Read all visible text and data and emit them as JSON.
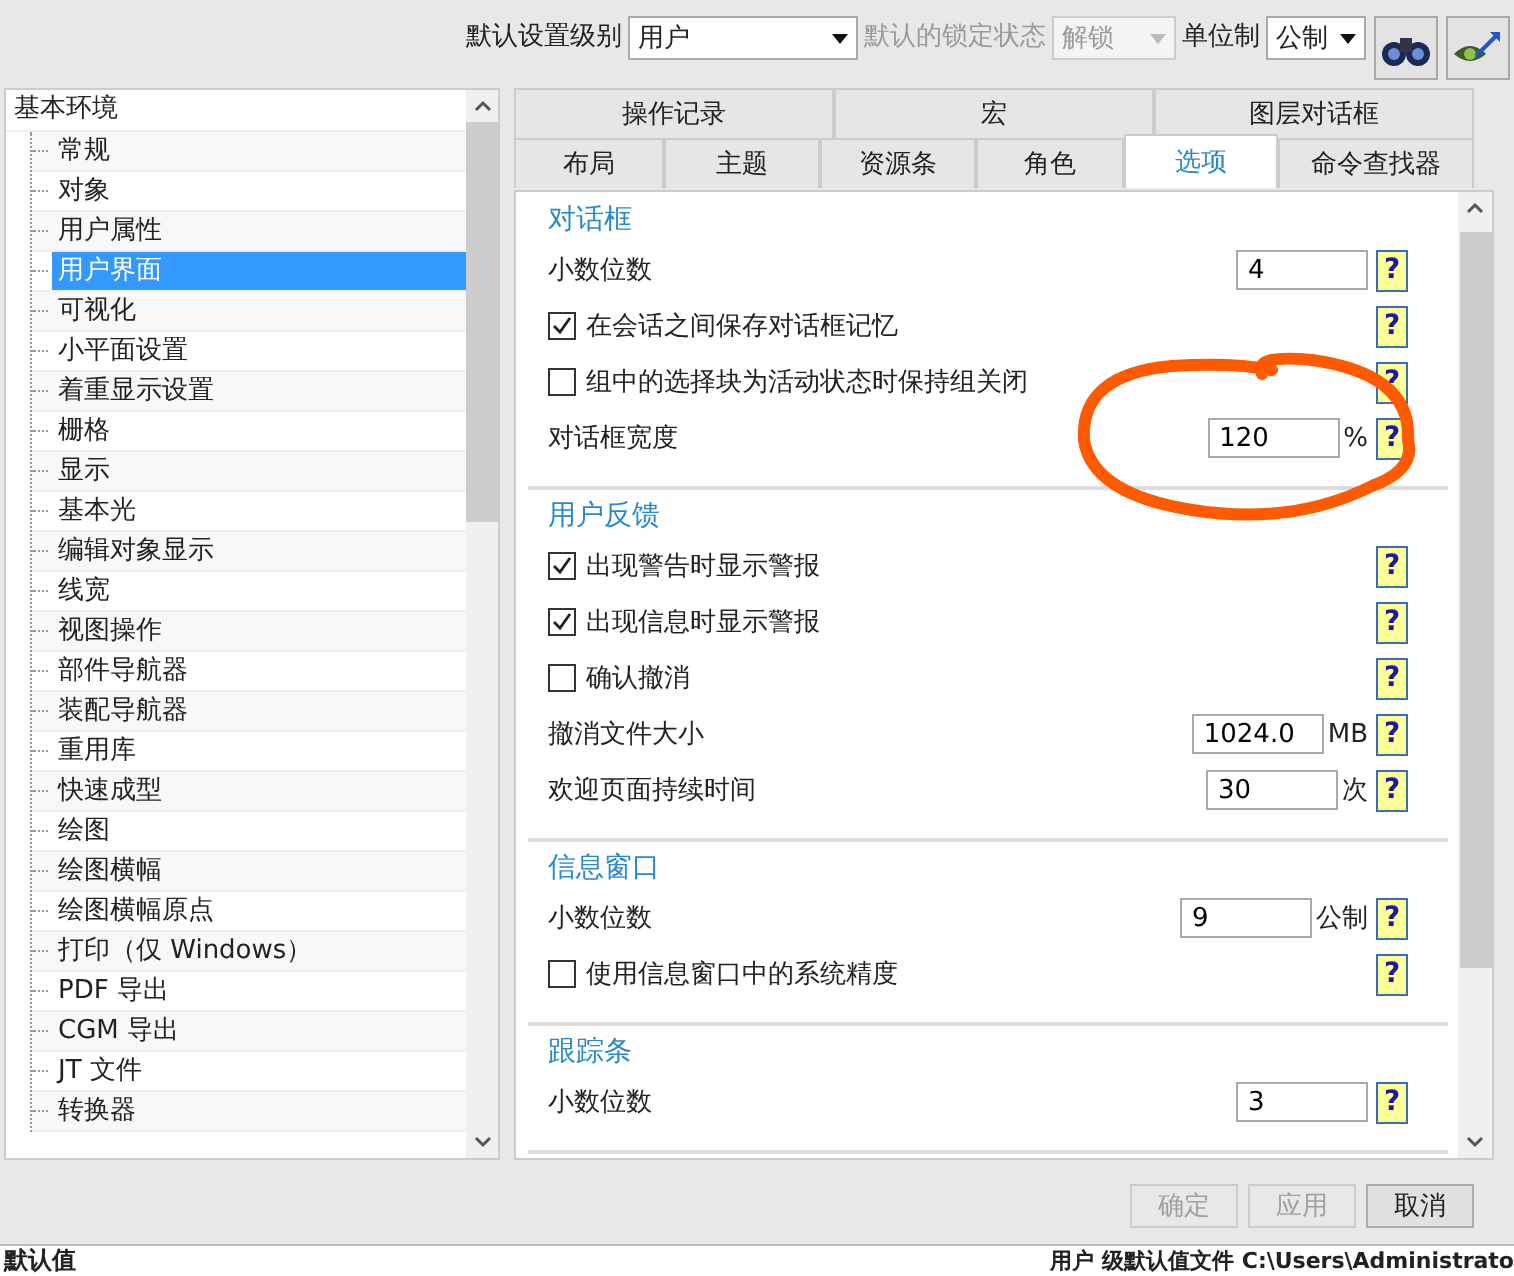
{
  "toolbar": {
    "level_label": "默认设置级别",
    "level_value": "用户",
    "lock_label": "默认的锁定状态",
    "lock_value": "解锁",
    "lock_disabled": true,
    "unit_label": "单位制",
    "unit_value": "公制"
  },
  "tree": {
    "label": "基本环境",
    "selected": false,
    "children": [
      {
        "label": "常规",
        "selected": false
      },
      {
        "label": "对象",
        "selected": false
      },
      {
        "label": "用户属性",
        "selected": false
      },
      {
        "label": "用户界面",
        "selected": true
      },
      {
        "label": "可视化",
        "selected": false
      },
      {
        "label": "小平面设置",
        "selected": false
      },
      {
        "label": "着重显示设置",
        "selected": false
      },
      {
        "label": "栅格",
        "selected": false
      },
      {
        "label": "显示",
        "selected": false
      },
      {
        "label": "基本光",
        "selected": false
      },
      {
        "label": "编辑对象显示",
        "selected": false
      },
      {
        "label": "线宽",
        "selected": false
      },
      {
        "label": "视图操作",
        "selected": false
      },
      {
        "label": "部件导航器",
        "selected": false
      },
      {
        "label": "装配导航器",
        "selected": false
      },
      {
        "label": "重用库",
        "selected": false
      },
      {
        "label": "快速成型",
        "selected": false
      },
      {
        "label": "绘图",
        "selected": false
      },
      {
        "label": "绘图横幅",
        "selected": false
      },
      {
        "label": "绘图横幅原点",
        "selected": false
      },
      {
        "label": "打印（仅 Windows）",
        "selected": false
      },
      {
        "label": "PDF 导出",
        "selected": false
      },
      {
        "label": "CGM 导出",
        "selected": false
      },
      {
        "label": "JT 文件",
        "selected": false
      },
      {
        "label": "转换器",
        "selected": false
      }
    ]
  },
  "tabs_row_1": [
    {
      "label": "操作记录",
      "selected": false
    },
    {
      "label": "宏",
      "selected": false
    },
    {
      "label": "图层对话框",
      "selected": false
    }
  ],
  "tabs_row_2": [
    {
      "label": "布局",
      "selected": false
    },
    {
      "label": "主题",
      "selected": false
    },
    {
      "label": "资源条",
      "selected": false
    },
    {
      "label": "角色",
      "selected": false
    },
    {
      "label": "选项",
      "selected": true
    },
    {
      "label": "命令查找器",
      "selected": false
    }
  ],
  "sections": [
    {
      "title": "对话框",
      "rows": [
        {
          "kind": "number",
          "label": "小数位数",
          "value": "4",
          "help": "?"
        },
        {
          "kind": "checkbox",
          "label": "在会话之间保存对话框记忆",
          "checked": true,
          "help": "?"
        },
        {
          "kind": "checkbox",
          "label": "组中的选择块为活动状态时保持组关闭",
          "checked": false,
          "help": "?"
        },
        {
          "kind": "number",
          "label": "对话框宽度",
          "value": "120",
          "unit": "%",
          "help": "?"
        }
      ]
    },
    {
      "title": "用户反馈",
      "rows": [
        {
          "kind": "checkbox",
          "label": "出现警告时显示警报",
          "checked": true,
          "help": "?"
        },
        {
          "kind": "checkbox",
          "label": "出现信息时显示警报",
          "checked": true,
          "help": "?"
        },
        {
          "kind": "checkbox",
          "label": "确认撤消",
          "checked": false,
          "help": "?"
        },
        {
          "kind": "number",
          "label": "撤消文件大小",
          "value": "1024.0",
          "unit": "MB",
          "help": "?"
        },
        {
          "kind": "number",
          "label": "欢迎页面持续时间",
          "value": "30",
          "unit": "次",
          "help": "?"
        }
      ]
    },
    {
      "title": "信息窗口",
      "rows": [
        {
          "kind": "number",
          "label": "小数位数",
          "value": "9",
          "unit": "公制",
          "help": "?"
        },
        {
          "kind": "checkbox",
          "label": "使用信息窗口中的系统精度",
          "checked": false,
          "help": "?"
        }
      ]
    },
    {
      "title": "跟踪条",
      "rows": [
        {
          "kind": "number",
          "label": "小数位数",
          "value": "3",
          "help": "?"
        }
      ]
    }
  ],
  "buttons": [
    {
      "label": "确定",
      "disabled": true
    },
    {
      "label": "应用",
      "disabled": true
    },
    {
      "label": "取消",
      "disabled": false
    }
  ],
  "status_bar": {
    "left": "默认值",
    "right": "用户 级默认值文件 C:\\Users\\Administrato"
  }
}
